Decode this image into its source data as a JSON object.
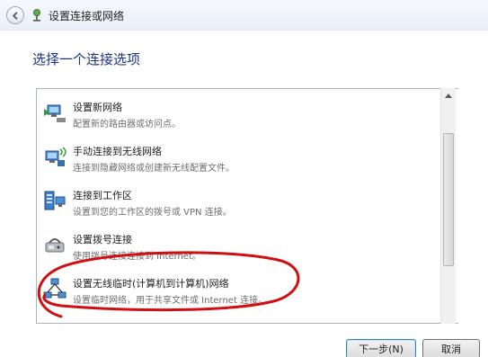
{
  "window": {
    "title": "设置连接或网络"
  },
  "heading": "选择一个连接选项",
  "options": [
    {
      "title": "设置新网络",
      "description": "配置新的路由器或访问点。",
      "icon": "network-router-icon"
    },
    {
      "title": "手动连接到无线网络",
      "description": "连接到隐藏网络或创建新无线配置文件。",
      "icon": "wireless-network-icon"
    },
    {
      "title": "连接到工作区",
      "description": "设置到您的工作区的拨号或 VPN 连接。",
      "icon": "workplace-vpn-icon"
    },
    {
      "title": "设置拨号连接",
      "description": "使用拨号连接连接到 Internet。",
      "icon": "dialup-modem-icon"
    },
    {
      "title": "设置无线临时(计算机到计算机)网络",
      "description": "设置临时网络，用于共享文件或 Internet 连接。",
      "icon": "adhoc-network-icon"
    }
  ],
  "buttons": {
    "next": "下一步(N)",
    "cancel": "取消"
  },
  "colors": {
    "heading": "#1e3287",
    "annotation": "#d01010"
  }
}
